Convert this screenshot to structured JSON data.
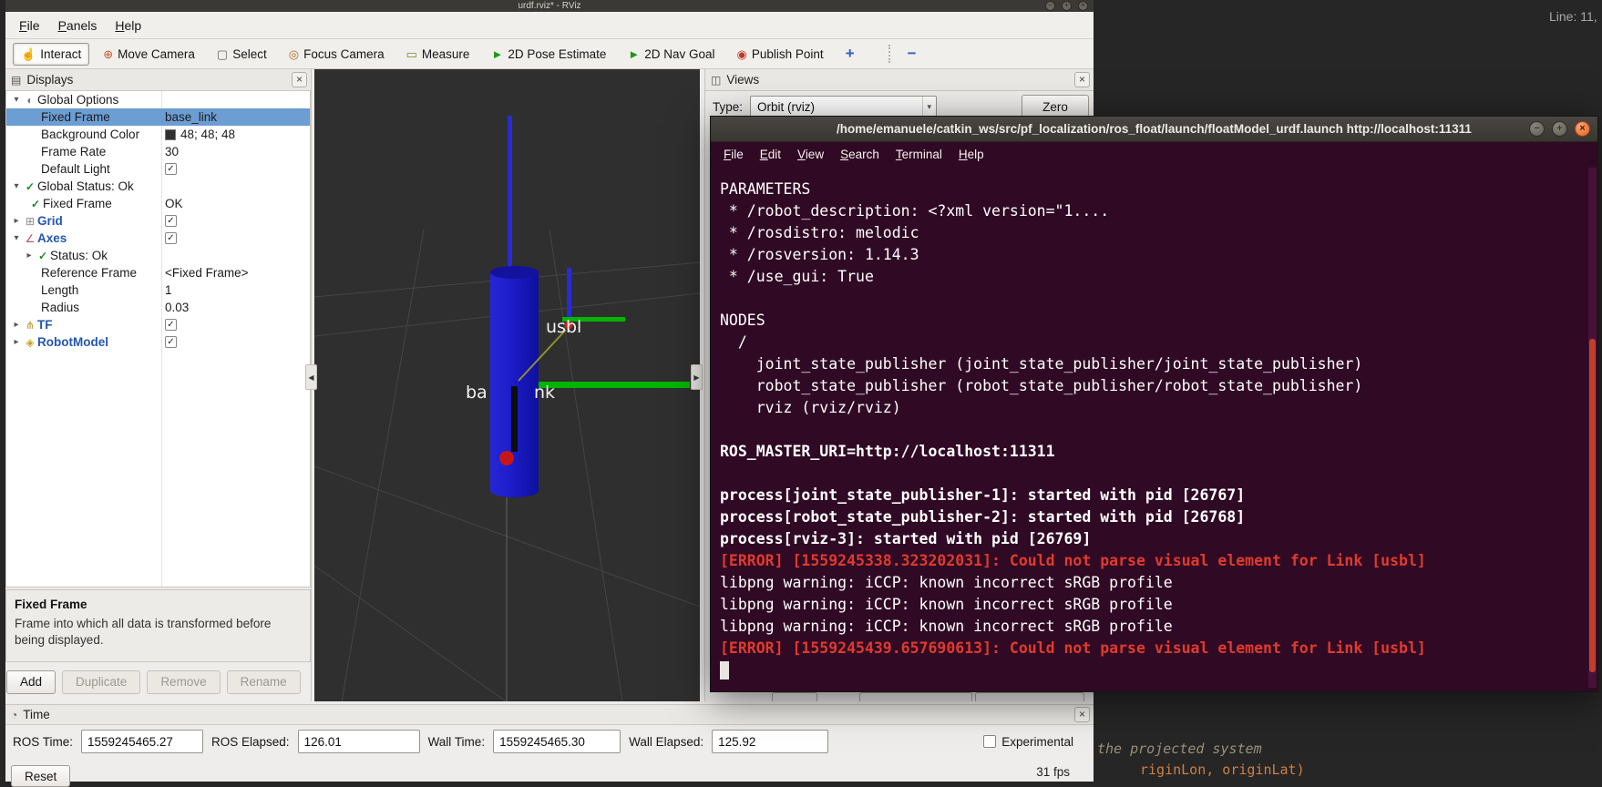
{
  "background_app": {
    "line_indicator": "Line: 11,",
    "code_fragment_1": "the projected system",
    "code_fragment_2": "riginLon, originLat)"
  },
  "icons": {
    "interact_hand": "☝",
    "move_camera": "⊕",
    "select_box": "▢",
    "focus_camera": "◎",
    "measure_ruler": "▭",
    "pose_arrow": "►",
    "nav_arrow": "►",
    "publish_point": "◉",
    "add_plus": "+",
    "remove_minus": "−",
    "displays_panel": "▤",
    "views_panel": "◫",
    "time_clock": "◔",
    "global_options": "◐",
    "status_check": "✓",
    "grid": "⊞",
    "axes": "∠",
    "tf": "⋔",
    "robot_model": "◈",
    "expander_open": "▾",
    "expander_closed": "▸",
    "dropdown_arrow": "▾",
    "close": "×",
    "window_min": "−",
    "window_max": "+",
    "window_close": "×",
    "collapse_left": "◀",
    "collapse_right": "▶"
  },
  "rviz": {
    "window_title": "urdf.rviz* - RViz",
    "menu": {
      "file": "File",
      "panels": "Panels",
      "help": "Help"
    },
    "toolbar": {
      "interact": "Interact",
      "move_camera": "Move Camera",
      "select": "Select",
      "focus_camera": "Focus Camera",
      "measure": "Measure",
      "pose_estimate": "2D Pose Estimate",
      "nav_goal": "2D Nav Goal",
      "publish_point": "Publish Point"
    },
    "displays": {
      "title": "Displays",
      "rows": [
        {
          "label": "Global Options"
        },
        {
          "label": "Fixed Frame",
          "value": "base_link"
        },
        {
          "label": "Background Color",
          "value": "48; 48; 48"
        },
        {
          "label": "Frame Rate",
          "value": "30"
        },
        {
          "label": "Default Light"
        },
        {
          "label": "Global Status: Ok"
        },
        {
          "label": "Fixed Frame",
          "value": "OK"
        },
        {
          "label": "Grid"
        },
        {
          "label": "Axes"
        },
        {
          "label": "Status: Ok"
        },
        {
          "label": "Reference Frame",
          "value": "<Fixed Frame>"
        },
        {
          "label": "Length",
          "value": "1"
        },
        {
          "label": "Radius",
          "value": "0.03"
        },
        {
          "label": "TF"
        },
        {
          "label": "RobotModel"
        }
      ],
      "help_title": "Fixed Frame",
      "help_text": "Frame into which all data is transformed before being displayed.",
      "buttons": {
        "add": "Add",
        "duplicate": "Duplicate",
        "remove": "Remove",
        "rename": "Rename"
      }
    },
    "viewport": {
      "label_usbl": "usbl",
      "label_base_link_left": "ba",
      "label_base_link_right": "nk"
    },
    "views": {
      "title": "Views",
      "type_label": "Type:",
      "type_value": "Orbit (rviz)",
      "zero_button": "Zero"
    },
    "time": {
      "title": "Time",
      "ros_time_label": "ROS Time:",
      "ros_time_value": "1559245465.27",
      "ros_elapsed_label": "ROS Elapsed:",
      "ros_elapsed_value": "126.01",
      "wall_time_label": "Wall Time:",
      "wall_time_value": "1559245465.30",
      "wall_elapsed_label": "Wall Elapsed:",
      "wall_elapsed_value": "125.92",
      "experimental_label": "Experimental",
      "fps": "31 fps",
      "reset_button": "Reset"
    }
  },
  "terminal": {
    "title": "/home/emanuele/catkin_ws/src/pf_localization/ros_float/launch/floatModel_urdf.launch http://localhost:11311",
    "menu": {
      "file": "File",
      "edit": "Edit",
      "view": "View",
      "search": "Search",
      "terminal": "Terminal",
      "help": "Help"
    },
    "lines": [
      "PARAMETERS",
      " * /robot_description: <?xml version=\"1....",
      " * /rosdistro: melodic",
      " * /rosversion: 1.14.3",
      " * /use_gui: True",
      "",
      "NODES",
      "  /",
      "    joint_state_publisher (joint_state_publisher/joint_state_publisher)",
      "    robot_state_publisher (robot_state_publisher/robot_state_publisher)",
      "    rviz (rviz/rviz)",
      "",
      "ROS_MASTER_URI=http://localhost:11311",
      "",
      "process[joint_state_publisher-1]: started with pid [26767]",
      "process[robot_state_publisher-2]: started with pid [26768]",
      "process[rviz-3]: started with pid [26769]",
      "[ERROR] [1559245338.323202031]: Could not parse visual element for Link [usbl]",
      "libpng warning: iCCP: known incorrect sRGB profile",
      "libpng warning: iCCP: known incorrect sRGB profile",
      "libpng warning: iCCP: known incorrect sRGB profile",
      "[ERROR] [1559245439.657690613]: Could not parse visual element for Link [usbl]"
    ]
  }
}
